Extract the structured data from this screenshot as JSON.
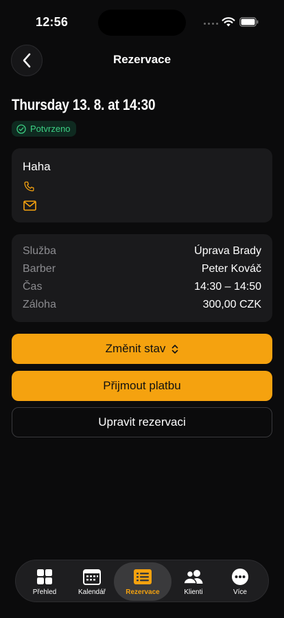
{
  "status_bar": {
    "time": "12:56"
  },
  "header": {
    "title": "Rezervace"
  },
  "booking": {
    "date": "Thursday 13. 8. at 14:30",
    "status": "Potvrzeno",
    "client_name": "Haha"
  },
  "details": [
    {
      "label": "Služba",
      "value": "Úprava Brady"
    },
    {
      "label": "Barber",
      "value": "Peter Kováč"
    },
    {
      "label": "Čas",
      "value": "14:30 – 14:50"
    },
    {
      "label": "Záloha",
      "value": "300,00 CZK"
    }
  ],
  "actions": {
    "change_status": "Změnit stav",
    "accept_payment": "Přijmout platbu",
    "edit_booking": "Upravit rezervaci"
  },
  "tabs": [
    {
      "label": "Přehled",
      "icon": "grid-icon"
    },
    {
      "label": "Kalendář",
      "icon": "calendar-icon"
    },
    {
      "label": "Rezervace",
      "icon": "reservation-list-icon",
      "active": true
    },
    {
      "label": "Klienti",
      "icon": "clients-icon"
    },
    {
      "label": "Více",
      "icon": "more-icon"
    }
  ],
  "colors": {
    "accent": "#f5a20f",
    "success": "#3ccf83",
    "background": "#0b0b0c",
    "card": "#1a1a1c"
  }
}
